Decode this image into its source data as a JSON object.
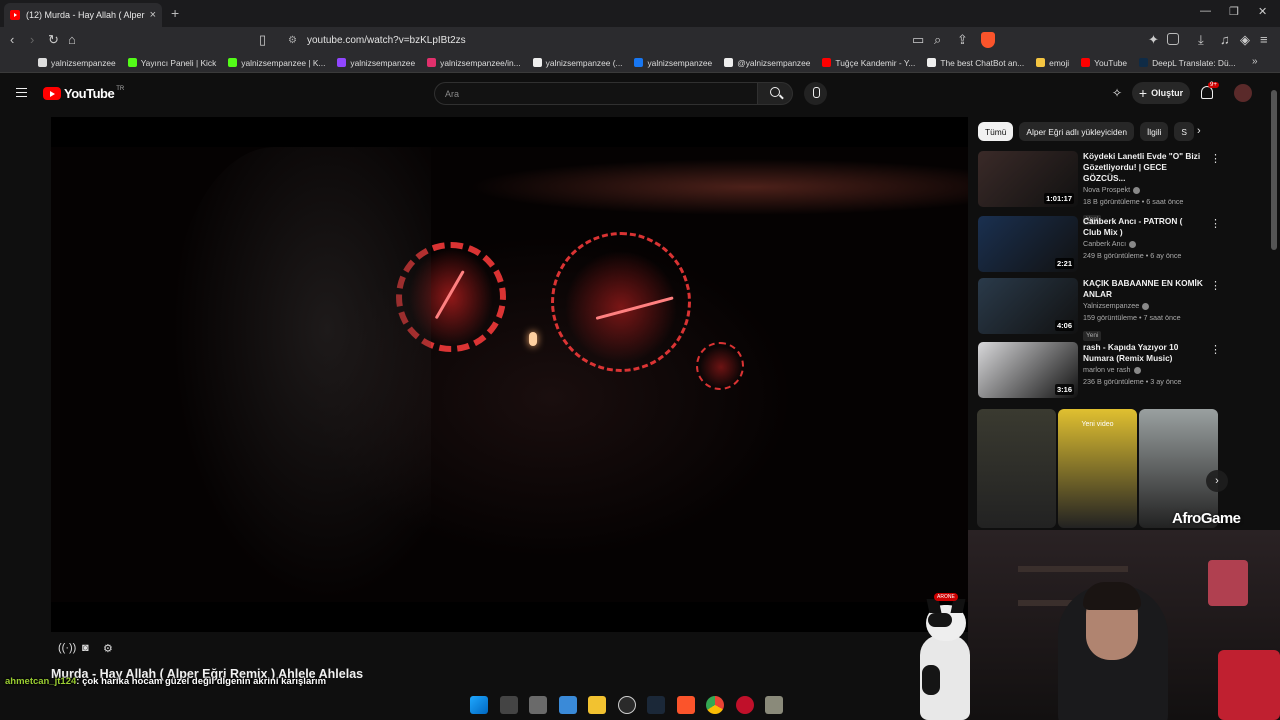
{
  "browser": {
    "tab_title": "(12) Murda - Hay Allah ( Alper E...",
    "new_tab": "+",
    "tab_close": "×",
    "url": "youtube.com/watch?v=bzKLpIBt2zs",
    "window_controls": [
      "—",
      "❐",
      "✕"
    ],
    "bookmarks": [
      {
        "label": "yalnizsempanzee",
        "color": "#dddddd"
      },
      {
        "label": "Yayıncı Paneli | Kick",
        "color": "#53fc18"
      },
      {
        "label": "yalnizsempanzee | K...",
        "color": "#53fc18"
      },
      {
        "label": "yalnizsempanzee",
        "color": "#9146ff"
      },
      {
        "label": "yalnizsempanzee/in...",
        "color": "#e1306c"
      },
      {
        "label": "yalnizsempanzee (...",
        "color": "#eeeeee"
      },
      {
        "label": "yalnizsempanzee",
        "color": "#1877f2"
      },
      {
        "label": "@yalnizsempanzee",
        "color": "#eeeeee"
      },
      {
        "label": "Tuğçe Kandemir - Y...",
        "color": "#ff0000"
      },
      {
        "label": "The best ChatBot an...",
        "color": "#eeeeee"
      },
      {
        "label": "emoji",
        "color": "#f4c542"
      },
      {
        "label": "YouTube",
        "color": "#ff0000"
      },
      {
        "label": "DeepL Translate: Dü...",
        "color": "#0f2b46"
      }
    ],
    "bookmarks_more": "»"
  },
  "youtube": {
    "logo_text": "YouTube",
    "region": "TR",
    "search_placeholder": "Ara",
    "create_label": "Oluştur",
    "notifications_badge": "9+"
  },
  "video": {
    "title": "Murda - Hay Allah ( Alper Eğri Remix ) Ahlele Ahlelas"
  },
  "chat_overlay": {
    "user": "ahmetcan_jt124",
    "message": ": çok harika hocam güzel değil dİgenin akrini karışlarım"
  },
  "chips": [
    {
      "label": "Tümü",
      "active": true
    },
    {
      "label": "Alper Eğri adlı yükleyiciden",
      "active": false
    },
    {
      "label": "İlgili",
      "active": false
    },
    {
      "label": "S",
      "active": false
    }
  ],
  "recommendations": [
    {
      "title": "Köydeki Lanetli Evde \"O\" Bizi Gözetliyordu! | GECE GÖZCÜS...",
      "channel": "Nova Prospekt",
      "meta": "18 B görüntüleme • 6 saat önce",
      "duration": "1:01:17",
      "new_badge": "Yeni",
      "thumb_color": "#3a2a28"
    },
    {
      "title": "Canberk Ancı - PATRON ( Club Mix )",
      "channel": "Canberk Ancı",
      "meta": "249 B görüntüleme • 6 ay önce",
      "duration": "2:21",
      "new_badge": "",
      "thumb_color": "#1a3050"
    },
    {
      "title": "KAÇIK BABAANNE EN KOMİK ANLAR",
      "channel": "Yalnizsempanzee",
      "meta": "159 görüntüleme • 7 saat önce",
      "duration": "4:06",
      "new_badge": "Yeni",
      "thumb_color": "#2a3a4a"
    },
    {
      "title": "rash - Kapıda Yazıyor 10 Numara (Remix Music)",
      "channel": "marlon ve rash",
      "meta": "236 B görüntüleme • 3 ay önce",
      "duration": "3:16",
      "new_badge": "",
      "thumb_color": "#d8d8da"
    }
  ],
  "shorts": [
    {
      "label": "",
      "color": "#3a3a30"
    },
    {
      "label": "Yeni video",
      "color": "#e0c030"
    },
    {
      "label": "",
      "color": "#9aa0a0"
    }
  ],
  "overlay_logo": "AfroGame",
  "cat_tag": "ARONE"
}
